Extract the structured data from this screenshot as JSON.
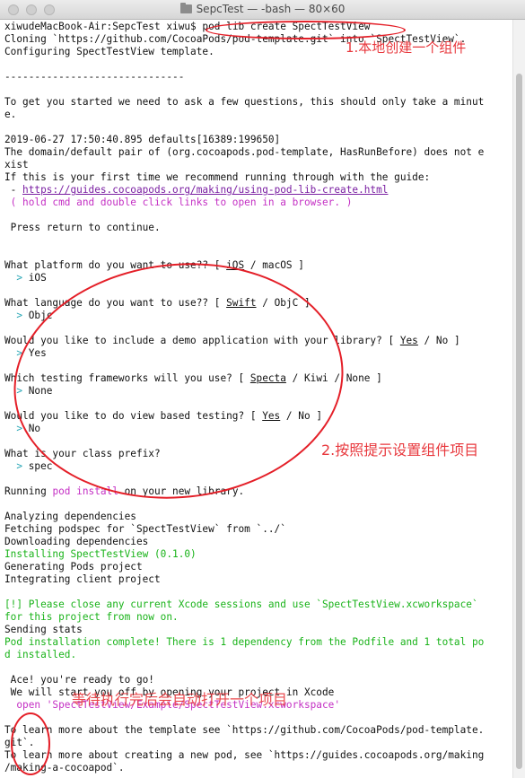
{
  "window": {
    "title": "SepcTest — -bash — 80×60"
  },
  "terminal": {
    "l01": {
      "a": "xiwudeMacBook-Air:SepcTest xiwu$ ",
      "b": "pod lib create SpectTestView"
    },
    "l02": "Cloning `https://github.com/CocoaPods/pod-template.git` into `SpectTestView`.",
    "l03": "Configuring SpectTestView template.",
    "l05": "------------------------------",
    "l07": "To get you started we need to ask a few questions, this should only take a minut",
    "l08": "e.",
    "l10": "2019-06-27 17:50:40.895 defaults[16389:199650]",
    "l11": "The domain/default pair of (org.cocoapods.pod-template, HasRunBefore) does not e",
    "l12": "xist",
    "l13": "If this is your first time we recommend running through with the guide:",
    "l14": {
      "a": " - ",
      "link": "https://guides.cocoapods.org/making/using-pod-lib-create.html"
    },
    "l15": " ( hold cmd and double click links to open in a browser. )",
    "l17": " Press return to continue.",
    "l20": {
      "a": "What platform do you want to use?? [ ",
      "u": "iOS",
      "b": " / macOS ]"
    },
    "l21": {
      "p": "  > ",
      "t": "iOS"
    },
    "l23": {
      "a": "What language do you want to use?? [ ",
      "u": "Swift",
      "b": " / ObjC ]"
    },
    "l24": {
      "p": "  > ",
      "t": "Objc"
    },
    "l26": {
      "a": "Would you like to include a demo application with your library? [ ",
      "u": "Yes",
      "b": " / No ]"
    },
    "l27": {
      "p": "  > ",
      "t": "Yes"
    },
    "l29": {
      "a": "Which testing frameworks will you use? [ ",
      "u": "Specta",
      "b": " / Kiwi / None ]"
    },
    "l30": {
      "p": "  > ",
      "t": "None"
    },
    "l32": {
      "a": "Would you like to do view based testing? [ ",
      "u": "Yes",
      "b": " / No ]"
    },
    "l33": {
      "p": "  > ",
      "t": "No"
    },
    "l35": "What is your class prefix?",
    "l36": {
      "p": "  > ",
      "t": "spec"
    },
    "l38": {
      "a": "Running ",
      "m": "pod install",
      "b": " on your new library."
    },
    "l40": "Analyzing dependencies",
    "l41": "Fetching podspec for `SpectTestView` from `../`",
    "l42": "Downloading dependencies",
    "l43": "Installing SpectTestView (0.1.0)",
    "l44": "Generating Pods project",
    "l45": "Integrating client project",
    "l47": "[!] Please close any current Xcode sessions and use `SpectTestView.xcworkspace`",
    "l48": "for this project from now on.",
    "l49": "Sending stats",
    "l50": "Pod installation complete! There is 1 dependency from the Podfile and 1 total po",
    "l51": "d installed.",
    "l53": " Ace! you're ready to go!",
    "l54": " We will start you off by opening your project in Xcode",
    "l55": "  open 'SpectTestView/Example/SpectTestView.xcworkspace'",
    "l57": "To learn more about the template see `https://github.com/CocoaPods/pod-template.",
    "l58": "git`.",
    "l59": "To learn more about creating a new pod, see `https://guides.cocoapods.org/making",
    "l60": "/making-a-cocoapod`."
  },
  "annotations": {
    "a1": "1.本地创建一个组件",
    "a2": "2.按照提示设置组件项目",
    "a3": "等待执行完后会自动打开一个项目"
  },
  "colors": {
    "annotation": "#e41f28",
    "magenta": "#c430c4",
    "green": "#19b319",
    "link": "#7a1fa2"
  }
}
